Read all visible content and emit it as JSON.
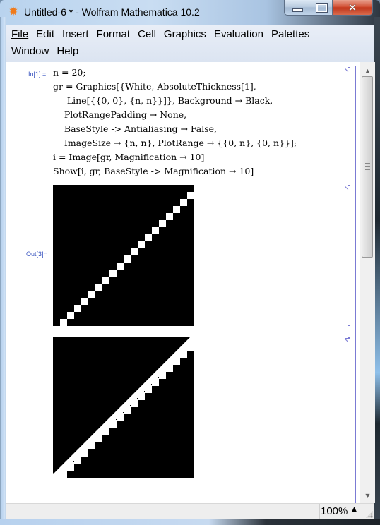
{
  "window": {
    "title": "Untitled-6 * - Wolfram Mathematica 10.2",
    "app_icon": "mathematica-spikey-icon",
    "controls": {
      "minimize": "minimize",
      "maximize": "maximize",
      "close": "close"
    }
  },
  "menubar": {
    "row1": [
      "File",
      "Edit",
      "Insert",
      "Format",
      "Cell",
      "Graphics",
      "Evaluation",
      "Palettes"
    ],
    "row2": [
      "Window",
      "Help"
    ]
  },
  "notebook": {
    "input_cell": {
      "label": "In[1]:=",
      "lines": [
        "n = 20;",
        "gr = Graphics[{White, AbsoluteThickness[1],",
        "     Line[{{0, 0}, {n, n}}]}, Background → Black,",
        "    PlotRangePadding → None,",
        "    BaseStyle -> Antialiasing → False,",
        "    ImageSize → {n, n}, PlotRange → {{0, n}, {0, n}}];",
        "i = Image[gr, Magnification → 10]",
        "Show[i, gr, BaseStyle -> Magnification → 10]"
      ]
    },
    "output_cells": [
      {
        "label": "Out[3]=",
        "description": "rasterized image 20x20 pixels, white staircase diagonal on black",
        "grid_size": 20,
        "foreground": "#ffffff",
        "background": "#000000"
      },
      {
        "label": "",
        "description": "raster image overlaid with vector line",
        "grid_size": 20,
        "foreground": "#ffffff",
        "background": "#000000"
      }
    ]
  },
  "statusbar": {
    "zoom": "100%",
    "zoom_arrow": "▲"
  },
  "colors": {
    "cell_label": "#3a55c0",
    "bracket": "#7b7bd4"
  }
}
